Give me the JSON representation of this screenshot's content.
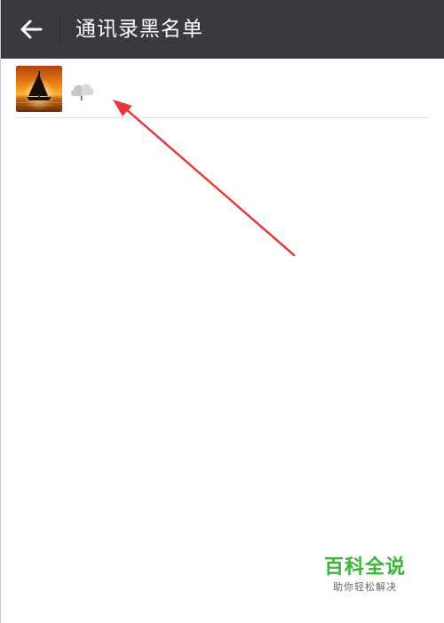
{
  "header": {
    "title": "通讯录黑名单",
    "back_icon": "arrow-left-icon"
  },
  "blacklist": {
    "items": [
      {
        "avatar": "sailboat-sunset-photo",
        "nickname_icon": "cloud-icon"
      }
    ]
  },
  "watermark": {
    "title": "百科全说",
    "subtitle": "助你轻松解决"
  },
  "colors": {
    "header_bg": "#383a3e",
    "annotation_arrow": "#e8393a",
    "watermark_green": "#3bb43a"
  }
}
